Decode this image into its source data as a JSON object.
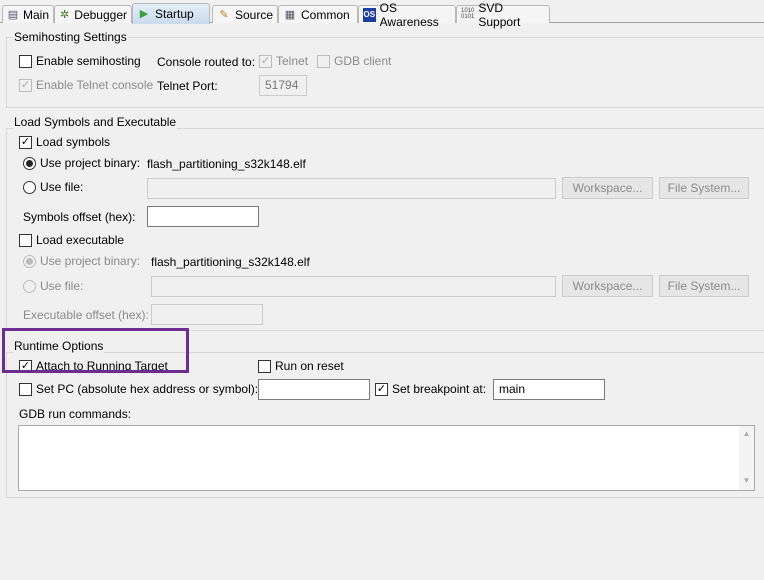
{
  "tabs": [
    {
      "label": "Main",
      "icon": "document-icon"
    },
    {
      "label": "Debugger",
      "icon": "bug-icon"
    },
    {
      "label": "Startup",
      "icon": "play-icon",
      "selected": true
    },
    {
      "label": "Source",
      "icon": "source-icon"
    },
    {
      "label": "Common",
      "icon": "table-icon"
    },
    {
      "label": "OS Awareness",
      "icon": "os-icon"
    },
    {
      "label": "SVD Support",
      "icon": "binary-icon"
    }
  ],
  "semihosting": {
    "title": "Semihosting Settings",
    "enable_semihosting": "Enable semihosting",
    "console_routed": "Console routed to:",
    "telnet": "Telnet",
    "gdb_client": "GDB client",
    "enable_telnet": "Enable Telnet console",
    "telnet_port_label": "Telnet Port:",
    "telnet_port": "51794"
  },
  "load": {
    "title": "Load Symbols and Executable",
    "load_symbols": "Load symbols",
    "use_project_binary": "Use project binary:",
    "binary": "flash_partitioning_s32k148.elf",
    "use_file": "Use file:",
    "workspace": "Workspace...",
    "file_system": "File System...",
    "symbols_offset": "Symbols offset (hex):",
    "load_executable": "Load executable",
    "exec_offset": "Executable offset (hex):"
  },
  "runtime": {
    "title": "Runtime Options",
    "attach": "Attach to Running Target",
    "run_on_reset": "Run on reset",
    "set_pc": "Set PC (absolute hex address or symbol):",
    "set_breakpoint": "Set breakpoint at:",
    "breakpoint_value": "main",
    "gdb_run_commands": "GDB run commands:"
  },
  "highlight_color": "#6b2d8f"
}
